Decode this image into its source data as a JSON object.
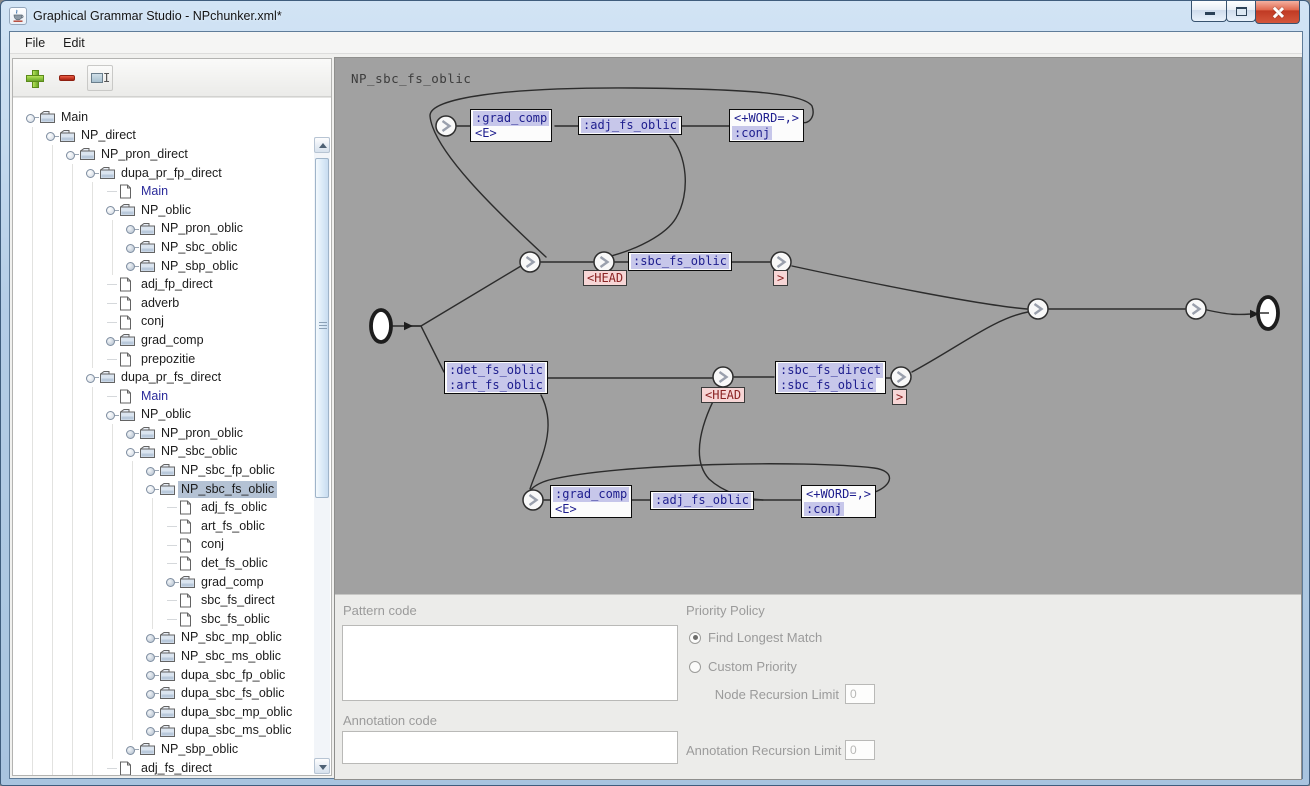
{
  "window": {
    "title": "Graphical Grammar Studio - NPchunker.xml*",
    "app_icon": "java-coffee-cup"
  },
  "menu": {
    "items": [
      {
        "label": "File"
      },
      {
        "label": "Edit"
      }
    ]
  },
  "toolbar": {
    "buttons": [
      {
        "name": "add"
      },
      {
        "name": "remove"
      },
      {
        "name": "rename"
      }
    ]
  },
  "tree": {
    "items": [
      {
        "label": "Main",
        "depth": 0,
        "cls": "folder h-open"
      },
      {
        "label": "NP_direct",
        "depth": 1,
        "cls": "folder h-open"
      },
      {
        "label": "NP_pron_direct",
        "depth": 2,
        "cls": "folder h-open"
      },
      {
        "label": "dupa_pr_fp_direct",
        "depth": 3,
        "cls": "folder h-open"
      },
      {
        "label": "Main",
        "depth": 4,
        "cls": "leaf h-leaf link"
      },
      {
        "label": "NP_oblic",
        "depth": 4,
        "cls": "folder h-open"
      },
      {
        "label": "NP_pron_oblic",
        "depth": 5,
        "cls": "folder h-closed"
      },
      {
        "label": "NP_sbc_oblic",
        "depth": 5,
        "cls": "folder h-closed"
      },
      {
        "label": "NP_sbp_oblic",
        "depth": 5,
        "cls": "folder h-closed"
      },
      {
        "label": "adj_fp_direct",
        "depth": 4,
        "cls": "leaf h-leaf"
      },
      {
        "label": "adverb",
        "depth": 4,
        "cls": "leaf h-leaf"
      },
      {
        "label": "conj",
        "depth": 4,
        "cls": "leaf h-leaf"
      },
      {
        "label": "grad_comp",
        "depth": 4,
        "cls": "folder h-closed"
      },
      {
        "label": "prepozitie",
        "depth": 4,
        "cls": "leaf h-leaf"
      },
      {
        "label": "dupa_pr_fs_direct",
        "depth": 3,
        "cls": "folder h-open"
      },
      {
        "label": "Main",
        "depth": 4,
        "cls": "leaf h-leaf link"
      },
      {
        "label": "NP_oblic",
        "depth": 4,
        "cls": "folder h-open"
      },
      {
        "label": "NP_pron_oblic",
        "depth": 5,
        "cls": "folder h-closed"
      },
      {
        "label": "NP_sbc_oblic",
        "depth": 5,
        "cls": "folder h-open"
      },
      {
        "label": "NP_sbc_fp_oblic",
        "depth": 6,
        "cls": "folder h-closed"
      },
      {
        "label": "NP_sbc_fs_oblic",
        "depth": 6,
        "cls": "folder h-open selected"
      },
      {
        "label": "adj_fs_oblic",
        "depth": 7,
        "cls": "leaf h-leaf"
      },
      {
        "label": "art_fs_oblic",
        "depth": 7,
        "cls": "leaf h-leaf"
      },
      {
        "label": "conj",
        "depth": 7,
        "cls": "leaf h-leaf"
      },
      {
        "label": "det_fs_oblic",
        "depth": 7,
        "cls": "leaf h-leaf"
      },
      {
        "label": "grad_comp",
        "depth": 7,
        "cls": "folder h-closed"
      },
      {
        "label": "sbc_fs_direct",
        "depth": 7,
        "cls": "leaf h-leaf"
      },
      {
        "label": "sbc_fs_oblic",
        "depth": 7,
        "cls": "leaf h-leaf"
      },
      {
        "label": "NP_sbc_mp_oblic",
        "depth": 6,
        "cls": "folder h-closed"
      },
      {
        "label": "NP_sbc_ms_oblic",
        "depth": 6,
        "cls": "folder h-closed"
      },
      {
        "label": "dupa_sbc_fp_oblic",
        "depth": 6,
        "cls": "folder h-closed"
      },
      {
        "label": "dupa_sbc_fs_oblic",
        "depth": 6,
        "cls": "folder h-closed"
      },
      {
        "label": "dupa_sbc_mp_oblic",
        "depth": 6,
        "cls": "folder h-closed"
      },
      {
        "label": "dupa_sbc_ms_oblic",
        "depth": 6,
        "cls": "folder h-closed"
      },
      {
        "label": "NP_sbp_oblic",
        "depth": 5,
        "cls": "folder h-closed"
      },
      {
        "label": "adj_fs_direct",
        "depth": 4,
        "cls": "leaf h-leaf"
      }
    ]
  },
  "graph": {
    "title": "NP_sbc_fs_oblic",
    "boxes": [
      {
        "id": "grad-comp-top",
        "lines": [
          {
            "text": ":grad_comp",
            "hl": true
          },
          {
            "text": "<E>",
            "hl": false
          }
        ]
      },
      {
        "id": "adj-fs-oblic-top",
        "lines": [
          {
            "text": ":adj_fs_oblic",
            "hl": true
          }
        ]
      },
      {
        "id": "word-conj-top",
        "lines": [
          {
            "text": "<+WORD=,>",
            "hl": false
          },
          {
            "text": ":conj",
            "hl": true
          }
        ]
      },
      {
        "id": "sbc-fs-oblic-mid",
        "lines": [
          {
            "text": ":sbc_fs_oblic",
            "hl": true
          }
        ]
      },
      {
        "id": "det-art-fs-oblic",
        "lines": [
          {
            "text": ":det_fs_oblic",
            "hl": true
          },
          {
            "text": ":art_fs_oblic",
            "hl": true
          }
        ]
      },
      {
        "id": "sbc-fs-direct-oblic",
        "lines": [
          {
            "text": ":sbc_fs_direct",
            "hl": true
          },
          {
            "text": ":sbc_fs_oblic",
            "hl": true
          }
        ]
      },
      {
        "id": "grad-comp-bottom",
        "lines": [
          {
            "text": ":grad_comp",
            "hl": true
          },
          {
            "text": "<E>",
            "hl": false
          }
        ]
      },
      {
        "id": "adj-fs-oblic-bottom",
        "lines": [
          {
            "text": ":adj_fs_oblic",
            "hl": true
          }
        ]
      },
      {
        "id": "word-conj-bottom",
        "lines": [
          {
            "text": "<+WORD=,>",
            "hl": false
          },
          {
            "text": ":conj",
            "hl": true
          }
        ]
      }
    ],
    "tags": [
      {
        "text": "<HEAD"
      },
      {
        "text": ">"
      },
      {
        "text": "<HEAD"
      },
      {
        "text": ">"
      }
    ]
  },
  "inspector": {
    "pattern_code_label": "Pattern code",
    "pattern_code_value": "",
    "annotation_code_label": "Annotation code",
    "annotation_code_value": "",
    "priority_policy_label": "Priority Policy",
    "radios": [
      {
        "label": "Find Longest Match",
        "selected": true
      },
      {
        "label": "Custom Priority",
        "selected": false
      }
    ],
    "node_recursion_label": "Node Recursion Limit",
    "node_recursion_value": "0",
    "annotation_recursion_label": "Annotation Recursion Limit",
    "annotation_recursion_value": "0"
  },
  "colors": {
    "graph_background": "#a1a1a1",
    "box_highlight": "#c7c7ea",
    "box_text": "#1e1e8e",
    "tag_pink_bg": "#f7d6d6",
    "tag_pink_text": "#8b2424",
    "tree_selection": "#b4c2d4",
    "link_text": "#2b2b9a",
    "titlebar": "#b4cde6",
    "close_button": "#c03a24"
  }
}
